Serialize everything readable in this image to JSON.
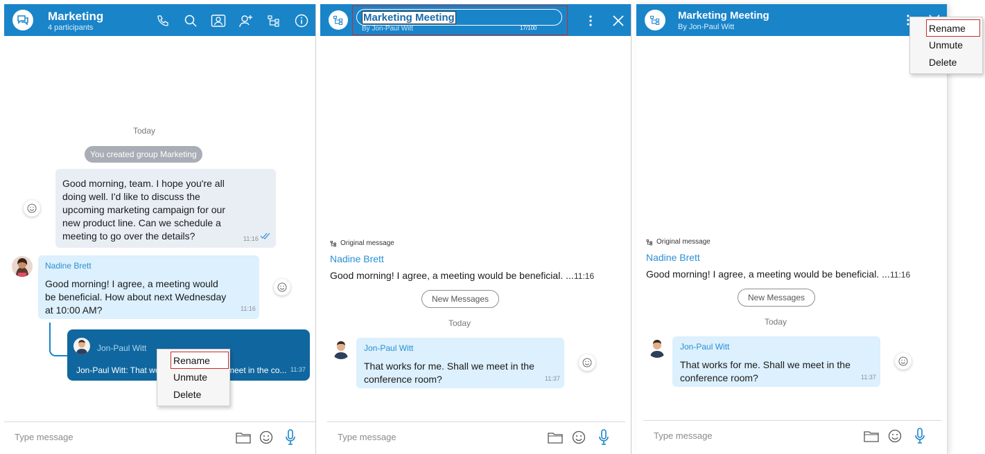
{
  "panel1": {
    "title": "Marketing",
    "subtitle": "4 participants",
    "header_icons": [
      "phone-icon",
      "search-icon",
      "contact-card-icon",
      "add-person-icon",
      "thread-icon",
      "info-icon"
    ],
    "day_label": "Today",
    "system_message": "You created group Marketing",
    "msg1": {
      "text": "Good morning, team. I hope you're all doing well. I'd like to discuss the upcoming marketing campaign for our new product line. Can we schedule a meeting to go over the details?",
      "time": "11:16"
    },
    "msg2": {
      "sender": "Nadine Brett",
      "text": "Good morning! I agree, a meeting would be beneficial. How about next Wednesday at 10:00 AM?",
      "time": "11:16"
    },
    "thread_reply": {
      "sender": "Jon-Paul Witt",
      "text": "Jon-Paul Witt: That wo",
      "text_tail": "meet in the co...",
      "time": "11:37"
    },
    "context_menu": [
      "Rename",
      "Unmute",
      "Delete"
    ],
    "composer_placeholder": "Type message"
  },
  "panel2": {
    "title_input_value": "Marketing Meeting",
    "subtitle": "By Jon-Paul Witt",
    "char_counter": "17/100",
    "original_message_label": "Original message",
    "orig_sender": "Nadine Brett",
    "orig_text": "Good morning! I agree, a meeting would be beneficial. ...",
    "orig_time": "11:16",
    "new_messages_label": "New Messages",
    "day_label": "Today",
    "reply": {
      "sender": "Jon-Paul Witt",
      "text": "That works for me. Shall we meet in the conference room?",
      "time": "11:37"
    },
    "composer_placeholder": "Type message"
  },
  "panel3": {
    "title": "Marketing Meeting",
    "subtitle": "By Jon-Paul Witt",
    "context_menu": [
      "Rename",
      "Unmute",
      "Delete"
    ],
    "original_message_label": "Original message",
    "orig_sender": "Nadine Brett",
    "orig_text": "Good morning! I agree, a meeting would be beneficial. ...",
    "orig_time": "11:16",
    "new_messages_label": "New Messages",
    "day_label": "Today",
    "reply": {
      "sender": "Jon-Paul Witt",
      "text": "That works for me. Shall we meet in the conference room?",
      "time": "11:37"
    },
    "composer_placeholder": "Type message"
  },
  "colors": {
    "header_blue": "#1a84c9",
    "thread_card": "#10679f",
    "incoming_bubble": "#dcf0fd",
    "outgoing_bubble": "#e9eef5",
    "sender_blue": "#2a90d4",
    "highlight_red": "#c72b2b"
  }
}
